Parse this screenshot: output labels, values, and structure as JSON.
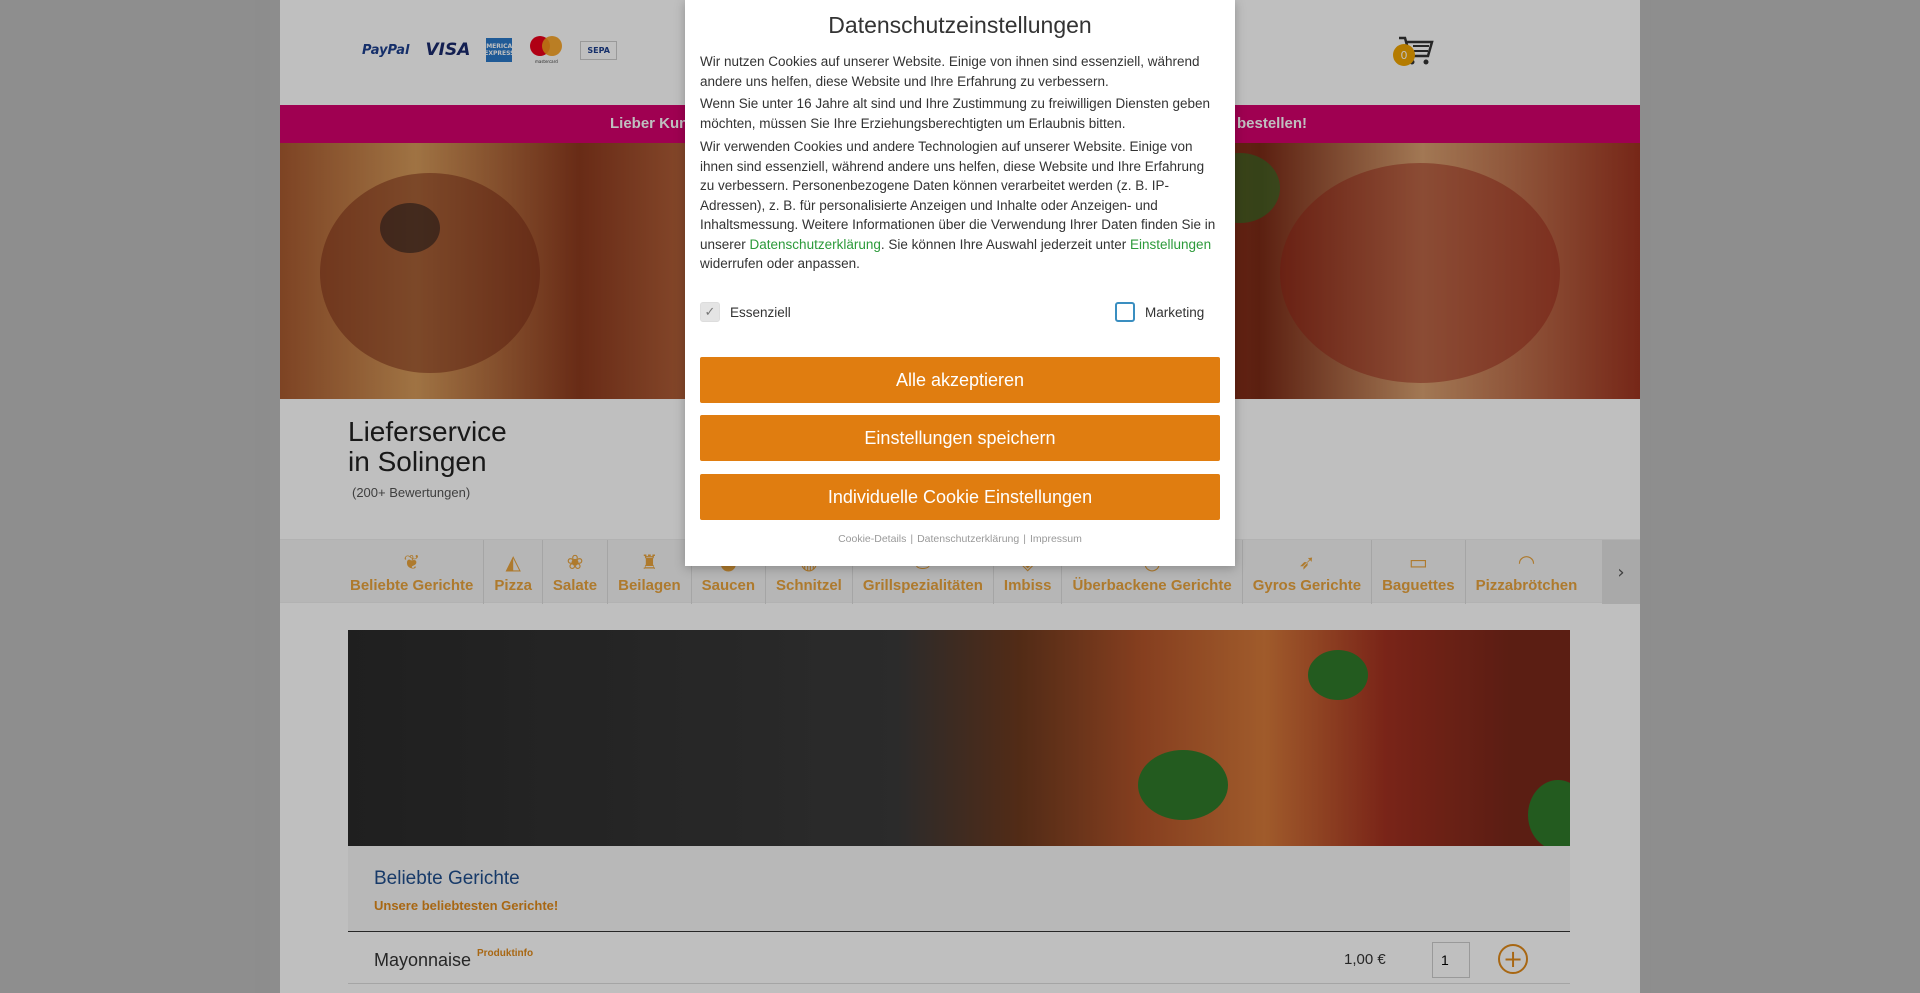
{
  "header": {
    "payment_methods": [
      {
        "name": "paypal",
        "label": "PayPal"
      },
      {
        "name": "visa",
        "label": "VISA"
      },
      {
        "name": "amex",
        "label": "AMERICAN EXPRESS"
      },
      {
        "name": "mastercard",
        "label": "mastercard"
      },
      {
        "name": "sepa",
        "label": "SEPA"
      }
    ],
    "cart_count": "0",
    "cart_icon": "cart-icon"
  },
  "promo": {
    "text_left": "Lieber Kun",
    "text_right": "bestellen!",
    "color": "#d5006d"
  },
  "shop": {
    "title_line1": "Lieferservice",
    "title_line2": "in Solingen",
    "reviews": "(200+ Bewertungen)"
  },
  "categories": [
    {
      "label": "Beliebte Gerichte",
      "icon": "popular-icon"
    },
    {
      "label": "Pizza",
      "icon": "pizza-icon"
    },
    {
      "label": "Salate",
      "icon": "salad-icon"
    },
    {
      "label": "Beilagen",
      "icon": "fries-icon"
    },
    {
      "label": "Saucen",
      "icon": "sauce-icon"
    },
    {
      "label": "Schnitzel",
      "icon": "schnitzel-icon"
    },
    {
      "label": "Grillspezialitäten",
      "icon": "grill-icon"
    },
    {
      "label": "Imbiss",
      "icon": "snack-icon"
    },
    {
      "label": "Überbackene Gerichte",
      "icon": "baked-icon"
    },
    {
      "label": "Gyros Gerichte",
      "icon": "gyros-icon"
    },
    {
      "label": "Baguettes",
      "icon": "baguette-icon"
    },
    {
      "label": "Pizzabrötchen",
      "icon": "pizza-roll-icon"
    }
  ],
  "section": {
    "title": "Beliebte Gerichte",
    "subtitle": "Unsere beliebtesten Gerichte!"
  },
  "product": {
    "name": "Mayonnaise",
    "info_label": "Produktinfo",
    "price": "1,00 €",
    "quantity": "1"
  },
  "dialog": {
    "title": "Datenschutzeinstellungen",
    "p1": "Wir nutzen Cookies auf unserer Website. Einige von ihnen sind essenziell, während andere uns helfen, diese Website und Ihre Erfahrung zu verbessern.",
    "p2": "Wenn Sie unter 16 Jahre alt sind und Ihre Zustimmung zu freiwilligen Diensten geben möchten, müssen Sie Ihre Erziehungsberechtigten um Erlaubnis bitten.",
    "p3_a": "Wir verwenden Cookies und andere Technologien auf unserer Website. Einige von ihnen sind essenziell, während andere uns helfen, diese Website und Ihre Erfahrung zu verbessern. Personenbezogene Daten können verarbeitet werden (z. B. IP-Adressen), z. B. für personalisierte Anzeigen und Inhalte oder Anzeigen- und Inhaltsmessung. Weitere Informationen über die Verwendung Ihrer Daten finden Sie in unserer ",
    "p3_link1": "Datenschutzerklärung",
    "p3_b": ". Sie können Ihre Auswahl jederzeit unter ",
    "p3_link2": "Einstellungen",
    "p3_c": " widerrufen oder anpassen.",
    "checkbox_essential": {
      "label": "Essenziell",
      "checked": true
    },
    "checkbox_marketing": {
      "label": "Marketing",
      "checked": false
    },
    "btn_accept_all": "Alle akzeptieren",
    "btn_save": "Einstellungen speichern",
    "btn_individual": "Individuelle Cookie Einstellungen",
    "footer_links": [
      "Cookie-Details",
      "Datenschutzerklärung",
      "Impressum"
    ],
    "accent_color": "#e07d10",
    "link_color": "#2c9a3a"
  }
}
